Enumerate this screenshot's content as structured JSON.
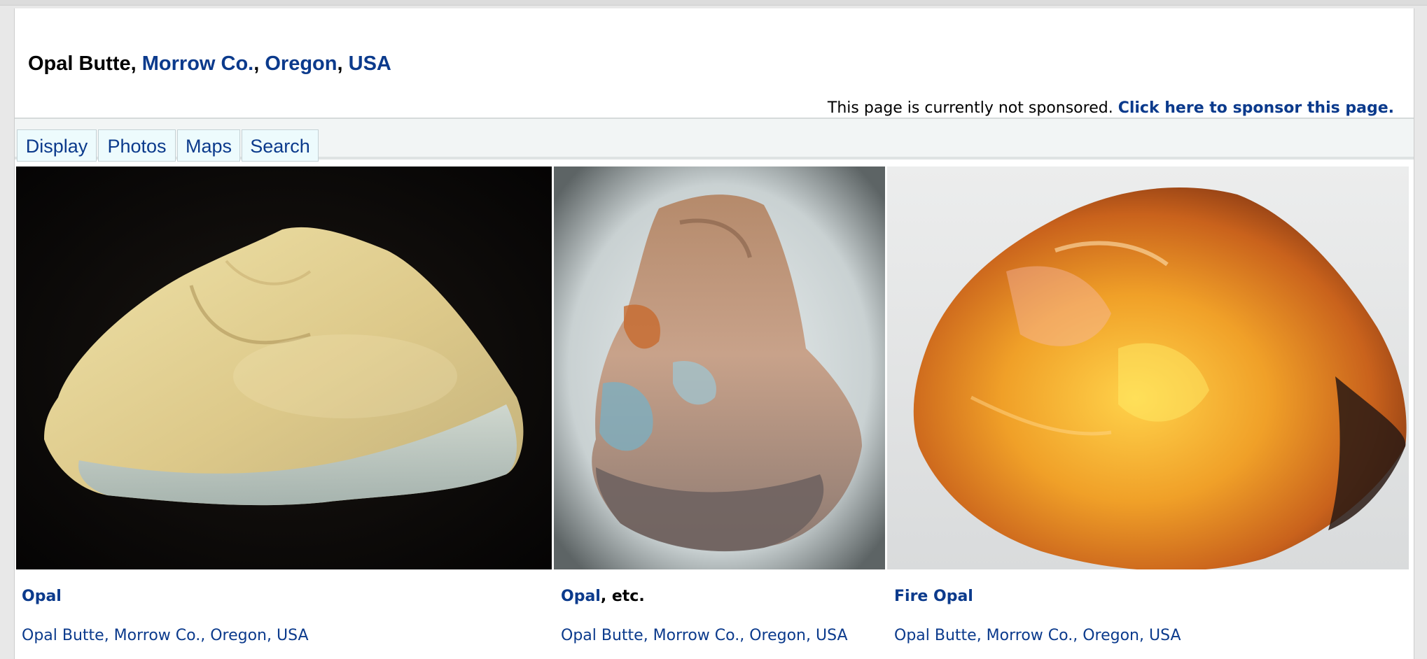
{
  "header": {
    "title_main": "Opal Butte",
    "sep1": ", ",
    "crumb_county": "Morrow Co.",
    "sep2": ", ",
    "crumb_state": "Oregon",
    "sep3": ", ",
    "crumb_country": "USA"
  },
  "sponsor": {
    "text": "This page is currently not sponsored.",
    "link": "Click here to sponsor this page."
  },
  "tabs": [
    {
      "label": "Display"
    },
    {
      "label": "Photos"
    },
    {
      "label": "Maps"
    },
    {
      "label": "Search"
    }
  ],
  "photos": [
    {
      "title": "Opal",
      "suffix": "",
      "location": "Opal Butte, Morrow Co., Oregon, USA"
    },
    {
      "title": "Opal",
      "suffix": ", etc.",
      "location": "Opal Butte, Morrow Co., Oregon, USA"
    },
    {
      "title": "Fire Opal",
      "suffix": "",
      "location": "Opal Butte, Morrow Co., Oregon, USA"
    }
  ],
  "colors": {
    "link": "#0b3a8c",
    "tab_bg": "#edfbfd",
    "tabbar_bg": "#f2f5f5"
  }
}
